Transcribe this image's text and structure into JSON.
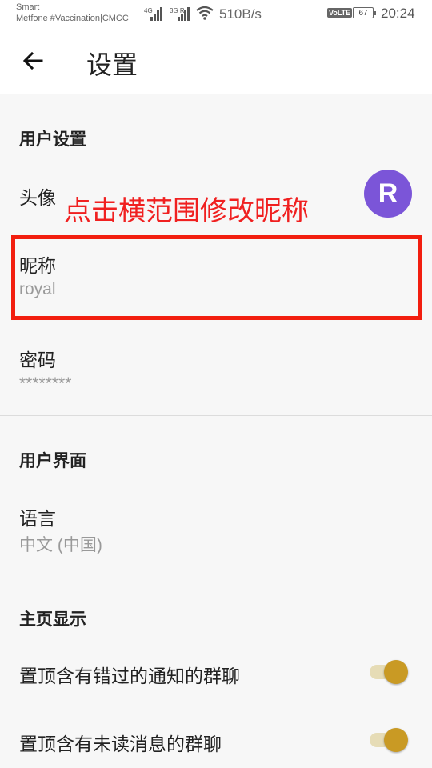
{
  "status_bar": {
    "carrier_line1": "Smart",
    "carrier_line2": "Metfone #Vaccination|CMCC",
    "signal1_label": "4G",
    "signal2_label": "3G R",
    "net_speed": "510B/s",
    "volte": "VoLTE",
    "battery": "67",
    "time": "20:24"
  },
  "app_bar": {
    "back_icon": "arrow-left-icon",
    "title": "设置"
  },
  "sections": {
    "user_settings": {
      "header": "用户设置",
      "avatar_label": "头像",
      "avatar_letter": "R",
      "avatar_color": "#7b55d8",
      "nickname_label": "昵称",
      "nickname_value": "royal",
      "password_label": "密码",
      "password_value": "********"
    },
    "ui": {
      "header": "用户界面",
      "language_label": "语言",
      "language_value": "中文 (中国)"
    },
    "home_display": {
      "header": "主页显示",
      "pin_missed_label": "置顶含有错过的通知的群聊",
      "pin_missed_on": true,
      "pin_unread_label": "置顶含有未读消息的群聊",
      "pin_unread_on": true
    }
  },
  "annotation": {
    "text": "点击横范围修改昵称",
    "color": "#f21e0f"
  },
  "colors": {
    "accent": "#c99a24",
    "background": "#f7f7f7"
  }
}
